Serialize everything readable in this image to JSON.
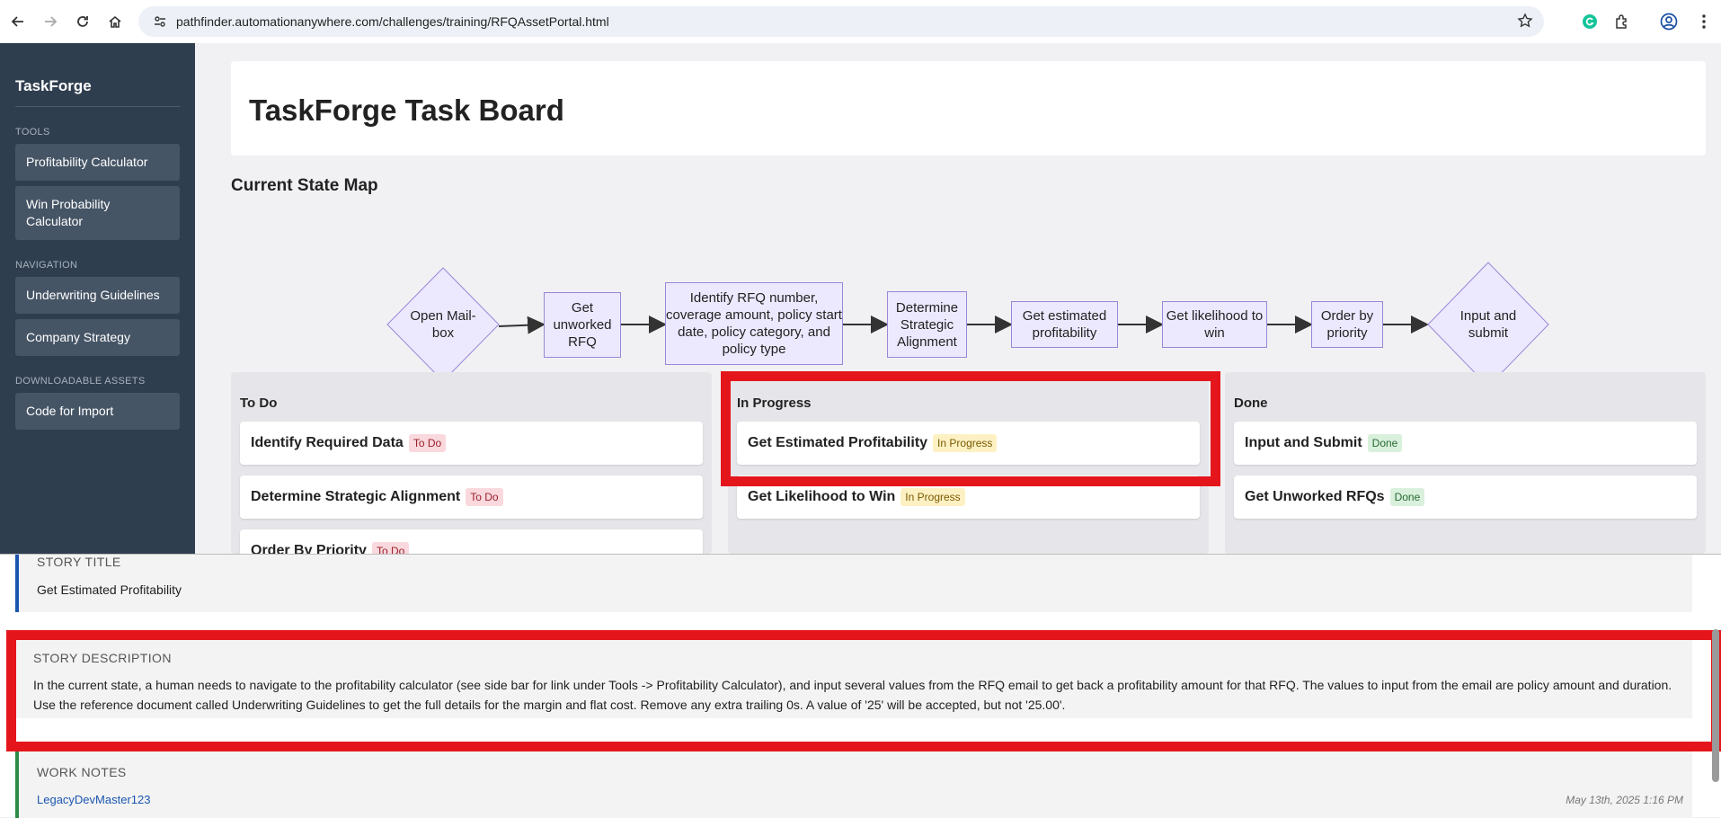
{
  "browser": {
    "url": "pathfinder.automationanywhere.com/challenges/training/RFQAssetPortal.html"
  },
  "sidebar": {
    "brand": "TaskForge",
    "sections": [
      {
        "label": "TOOLS",
        "items": [
          "Profitability Calculator",
          "Win Probability Calculator"
        ]
      },
      {
        "label": "NAVIGATION",
        "items": [
          "Underwriting Guidelines",
          "Company Strategy"
        ]
      },
      {
        "label": "DOWNLOADABLE ASSETS",
        "items": [
          "Code for Import"
        ]
      }
    ]
  },
  "header": {
    "title": "TaskForge Task Board"
  },
  "state_map": {
    "title": "Current State Map",
    "nodes": [
      "Open Mail- box",
      "Get unworked RFQ",
      "Identify RFQ number, coverage amount, policy start date, policy category, and policy type",
      "Determine Strategic Alignment",
      "Get estimated profitability",
      "Get likelihood to win",
      "Order by priority",
      "Input and submit"
    ]
  },
  "board": {
    "columns": [
      {
        "title": "To Do",
        "tasks": [
          {
            "name": "Identify Required Data",
            "badge": "To Do"
          },
          {
            "name": "Determine Strategic Alignment",
            "badge": "To Do"
          },
          {
            "name": "Order By Priority",
            "badge": "To Do"
          }
        ]
      },
      {
        "title": "In Progress",
        "tasks": [
          {
            "name": "Get Estimated Profitability",
            "badge": "In Progress"
          },
          {
            "name": "Get Likelihood to Win",
            "badge": "In Progress"
          }
        ]
      },
      {
        "title": "Done",
        "tasks": [
          {
            "name": "Input and Submit",
            "badge": "Done"
          },
          {
            "name": "Get Unworked RFQs",
            "badge": "Done"
          }
        ]
      }
    ]
  },
  "details": {
    "story_title_label": "STORY TITLE",
    "story_title": "Get Estimated Profitability",
    "story_description_label": "STORY DESCRIPTION",
    "story_description_line1": "In the current state, a human needs to navigate to the profitability calculator (see side bar for link under Tools -> Profitability Calculator), and input several values from the RFQ email to get back a profitability amount for that RFQ. The values to input from the email are policy amount and duration.",
    "story_description_line2": "Use the reference document called Underwriting Guidelines to get the full details for the margin and flat cost.  Remove any extra trailing 0s.  A value of '25' will be accepted, but not '25.00'.",
    "work_notes_label": "WORK NOTES",
    "work_note_author": "LegacyDevMaster123",
    "work_note_time": "May 13th, 2025 1:16 PM"
  },
  "colors": {
    "sidebar": "#2f3e4f",
    "node_fill": "#ece9fe",
    "node_stroke": "#9b86d8",
    "highlight": "#e4161c"
  }
}
